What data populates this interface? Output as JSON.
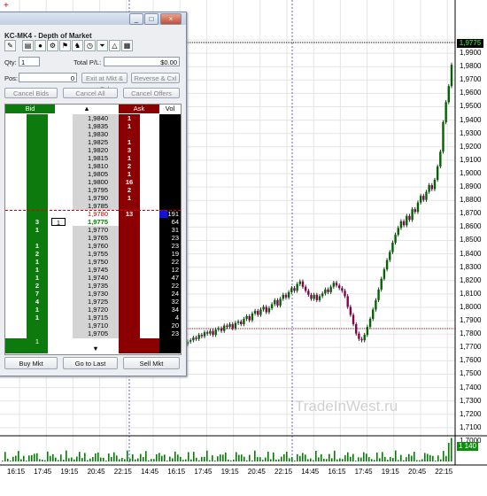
{
  "window": {
    "title": "KC-MK4 - Depth of Market",
    "min_label": "_",
    "max_label": "□",
    "close_label": "×"
  },
  "toolbar_icons": [
    "order-icon",
    "page-icon",
    "circle-icon",
    "gear-icon",
    "flag-icon",
    "figure-icon",
    "clock-icon",
    "funnel-icon",
    "triangle-icon",
    "palette-icon"
  ],
  "fields": {
    "qty_label": "Qty:",
    "qty_value": "1",
    "pl_label": "Total P/L:",
    "pl_value": "$0.00",
    "pos_label": "Pos:",
    "pos_value": "0"
  },
  "buttons": {
    "exit_mkt": "Exit at Mkt & Cxl",
    "reverse": "Reverse & Cxl",
    "cancel_bids": "Cancel Bids",
    "cancel_all": "Cancel All",
    "cancel_offers": "Cancel Offers",
    "buy_mkt": "Buy Mkt",
    "go_last": "Go to Last",
    "sell_mkt": "Sell Mkt"
  },
  "ladder_headers": {
    "bid": "Bid",
    "price": "▲",
    "ask": "Ask",
    "vol": "Vol"
  },
  "ladder_rows": [
    {
      "price": "1,9840",
      "ask": "1",
      "vol": ""
    },
    {
      "price": "1,9835",
      "ask": "1",
      "vol": ""
    },
    {
      "price": "1,9830",
      "ask": "",
      "vol": ""
    },
    {
      "price": "1,9825",
      "ask": "1",
      "vol": ""
    },
    {
      "price": "1,9820",
      "ask": "3",
      "vol": ""
    },
    {
      "price": "1,9815",
      "ask": "1",
      "vol": ""
    },
    {
      "price": "1,9810",
      "ask": "2",
      "vol": ""
    },
    {
      "price": "1,9805",
      "ask": "1",
      "vol": ""
    },
    {
      "price": "1,9800",
      "ask": "16",
      "vol": ""
    },
    {
      "price": "1,9795",
      "ask": "2",
      "vol": ""
    },
    {
      "price": "1,9790",
      "ask": "1",
      "vol": ""
    },
    {
      "price": "1,9785",
      "ask": "",
      "vol": ""
    },
    {
      "price": "1,9780",
      "ask": "13",
      "vol": "191",
      "hl": "red"
    },
    {
      "price": "1,9775",
      "bid": "3",
      "vol": "64",
      "hl": "green",
      "mine": "1"
    },
    {
      "price": "1,9770",
      "bid": "1",
      "vol": "31"
    },
    {
      "price": "1,9765",
      "bid": "",
      "vol": "23"
    },
    {
      "price": "1,9760",
      "bid": "1",
      "vol": "23"
    },
    {
      "price": "1,9755",
      "bid": "2",
      "vol": "19"
    },
    {
      "price": "1,9750",
      "bid": "1",
      "vol": "22"
    },
    {
      "price": "1,9745",
      "bid": "1",
      "vol": "12"
    },
    {
      "price": "1,9740",
      "bid": "1",
      "vol": "47"
    },
    {
      "price": "1,9735",
      "bid": "2",
      "vol": "22"
    },
    {
      "price": "1,9730",
      "bid": "7",
      "vol": "24"
    },
    {
      "price": "1,9725",
      "bid": "4",
      "vol": "32"
    },
    {
      "price": "1,9720",
      "bid": "1",
      "vol": "34"
    },
    {
      "price": "1,9715",
      "bid": "1",
      "vol": "4"
    },
    {
      "price": "1,9710",
      "bid": "",
      "vol": "20"
    },
    {
      "price": "1,9705",
      "bid": "",
      "vol": "23"
    }
  ],
  "ladder_footer": {
    "bid": "1",
    "price": "▼"
  },
  "price_axis": [
    "1,9900",
    "1,9800",
    "1,9700",
    "1,9600",
    "1,9500",
    "1,9400",
    "1,9300",
    "1,9200",
    "1,9100",
    "1,9000",
    "1,8900",
    "1,8800",
    "1,8700",
    "1,8600",
    "1,8500",
    "1,8400",
    "1,8300",
    "1,8200",
    "1,8100",
    "1,8000",
    "1,7900",
    "1,7800",
    "1,7700",
    "1,7600",
    "1,7500",
    "1,7400",
    "1,7300",
    "1,7200",
    "1,7100",
    "1,7000"
  ],
  "current_price": "1,9775",
  "volume_tag": "1 140",
  "time_axis": [
    "16:15",
    "17:45",
    "19:15",
    "20:45",
    "22:15",
    "14:45",
    "16:15",
    "17:45",
    "19:15",
    "20:45",
    "22:15",
    "14:45",
    "16:15",
    "17:45",
    "19:15",
    "20:45",
    "22:15"
  ],
  "watermark": "TradeInWest.ru",
  "colors": {
    "bid": "#008000",
    "ask": "#8b0000",
    "vol": "#000000",
    "bull": "#006400",
    "bear": "#8b0050",
    "volbar": "#008000"
  }
}
